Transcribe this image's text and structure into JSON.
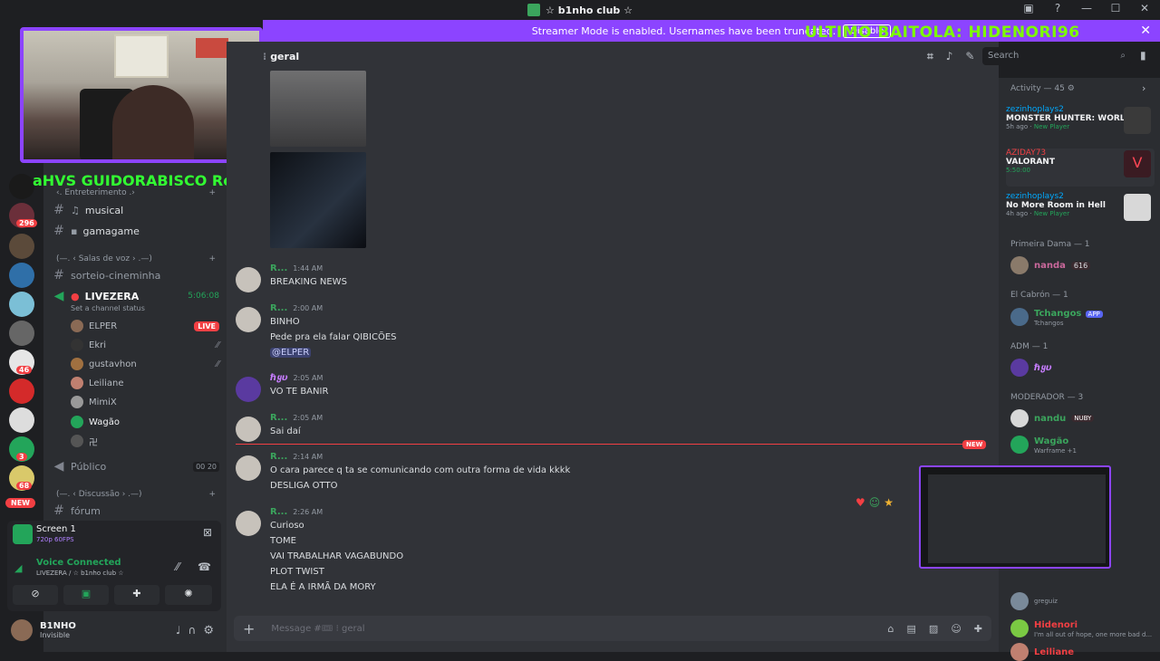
{
  "app": {
    "title": "☆ b1nho club ☆"
  },
  "banner": {
    "text": "Streamer Mode is enabled. Usernames have been truncated.",
    "button": "Disable"
  },
  "overlay": {
    "title": "ULTIMO BAITOLA: HIDENORI96",
    "ticker": "aHVS   GUIDORABISCO   Rog"
  },
  "servers": {
    "badges": [
      "296",
      "46",
      "3",
      "68"
    ],
    "new_label": "NEW"
  },
  "channels": {
    "ent_category": "‹. Entreterimento .›",
    "musical": "musical",
    "gamagame": "gamagame",
    "voice_category": "(—. ‹ Salas de voz › .—)",
    "sorteio": "sorteio-cineminha",
    "livezera": "LIVEZERA",
    "livezera_timer": "5:06:08",
    "status_placeholder": "Set a channel status",
    "voice_users": [
      {
        "name": "ELPER",
        "tag": "LIVE"
      },
      {
        "name": "Ekri",
        "tag": ""
      },
      {
        "name": "gustavhon",
        "tag": ""
      },
      {
        "name": "Leiliane",
        "tag": ""
      },
      {
        "name": "MimiX",
        "tag": ""
      },
      {
        "name": "Wagão",
        "tag": ""
      },
      {
        "name": "卍",
        "tag": ""
      }
    ],
    "publico": "Público",
    "publico_count_a": "00",
    "publico_count_b": "20",
    "disc_category": "(—. ‹ Discussão › .—)",
    "forum": "fórum"
  },
  "stream_panel": {
    "screen": "Screen 1",
    "quality": "720p 60FPS",
    "voice_status": "Voice Connected",
    "voice_location": "LIVEZERA / ☆ b1nho club ☆"
  },
  "user": {
    "name": "B1NHO",
    "status": "Invisible"
  },
  "header": {
    "channel": "geral",
    "search_placeholder": "Search"
  },
  "messages": [
    {
      "author": "R...",
      "time": "1:44 AM",
      "lines": [
        "BREAKING NEWS"
      ]
    },
    {
      "author": "R...",
      "time": "2:00 AM",
      "lines": [
        "BINHO",
        "Pede pra ela falar QIBICÕES"
      ],
      "mention": "@ELPER"
    },
    {
      "author": "ℏყυ",
      "time": "2:05 AM",
      "lines": [
        "VO TE BANIR"
      ]
    },
    {
      "author": "R...",
      "time": "2:05 AM",
      "lines": [
        "Sai daí"
      ]
    },
    {
      "author": "R...",
      "time": "2:14 AM",
      "lines": [
        "O cara parece q ta se comunicando com outra forma de vida kkkk",
        "DESLIGA OTTO"
      ]
    },
    {
      "author": "R...",
      "time": "2:26 AM",
      "lines": [
        "Curioso",
        "TOME",
        "VAI TRABALHAR VAGABUNDO",
        "PLOT TWIST",
        "ELA É A IRMÃ DA MORY"
      ]
    }
  ],
  "new_label": "NEW",
  "composer": {
    "placeholder": "Message #🎟 ⁝ geral"
  },
  "activity": {
    "header": "Activity — 45",
    "cards": [
      {
        "user": "zezinhoplays2",
        "game": "MONSTER HUNTER: WORLD",
        "meta": "5h ago",
        "tag": "New Player"
      },
      {
        "user": "AZIDAY73",
        "game": "VALORANT",
        "meta": "5:50:00",
        "tag": ""
      },
      {
        "user": "zezinhoplays2",
        "game": "No More Room in Hell",
        "meta": "4h ago",
        "tag": "New Player"
      }
    ]
  },
  "members": {
    "primeira_dama": "Primeira Dama — 1",
    "nanda": "nanda",
    "nanda_badge": "616",
    "el_cabron": "El Cabrón — 1",
    "tchangos": "Tchangos",
    "tchangos_badge": "APP",
    "tchangos_sub": "Tchangos",
    "adm": "ADM — 1",
    "hyu": "ℏყυ",
    "moderador": "MODERADOR — 3",
    "nandu": "nandu",
    "nandu_badge": "NUBY",
    "wagao": "Wagão",
    "wagao_sub": "Warframe +1",
    "greguiz_sub": "greguiz",
    "hidenori": "Hidenori",
    "hidenori_sub": "I'm all out of hope, one more bad d...",
    "leiliane": "Leiliane"
  }
}
